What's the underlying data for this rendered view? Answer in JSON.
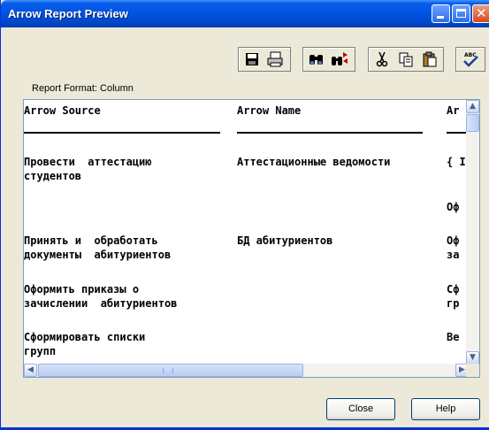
{
  "window": {
    "title": "Arrow Report Preview"
  },
  "toolbar": {
    "buttons": [
      {
        "name": "save-button",
        "icon": "floppy-disk-icon"
      },
      {
        "name": "print-button",
        "icon": "printer-icon"
      },
      {
        "name": "find-button",
        "icon": "binoculars-icon"
      },
      {
        "name": "find-replace-button",
        "icon": "binoculars-replace-icon"
      },
      {
        "name": "cut-button",
        "icon": "scissors-icon"
      },
      {
        "name": "copy-button",
        "icon": "copy-icon"
      },
      {
        "name": "paste-button",
        "icon": "clipboard-icon"
      },
      {
        "name": "spellcheck-button",
        "icon": "spellcheck-icon",
        "text": "ABC"
      }
    ]
  },
  "report": {
    "format_label": "Report Format: Column",
    "columns": [
      "Arrow Source",
      "Arrow Name",
      "Ar"
    ],
    "rows": [
      {
        "source": "Провести  аттестацию\nстудентов",
        "name": "Аттестационные ведомости",
        "third": "{ I"
      },
      {
        "source": "",
        "name": "",
        "third": "Оф"
      },
      {
        "source": "Принять и  обработать\nдокументы  абитуриентов",
        "name": "БД абитуриентов",
        "third": "Оф\nза"
      },
      {
        "source": "Оформить приказы о\nзачислении  абитуриентов",
        "name": "",
        "third": "Сф\nгр"
      },
      {
        "source": "Сформировать списки\nгрупп",
        "name": "",
        "third": "Ве"
      }
    ]
  },
  "buttons": {
    "close": "Close",
    "help": "Help"
  },
  "colors": {
    "titlebar": "#0054e3",
    "window_bg": "#ece9d8",
    "border": "#0831d9"
  }
}
